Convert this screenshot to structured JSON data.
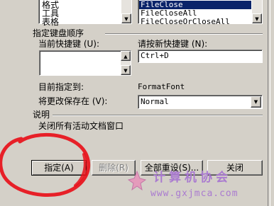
{
  "categories": {
    "items": [
      "格式",
      "工具",
      "表格"
    ]
  },
  "commands": {
    "items": [
      "FileClose",
      "FileCloseAll",
      "FileCloseOrCloseAll"
    ],
    "selected_index": 0
  },
  "keyboard": {
    "group_label": "指定键盘顺序",
    "current_keys_label": "当前快捷键 (U):",
    "new_key_label": "请按新快捷键 (N):",
    "new_key_value": "Ctrl+D",
    "assigned_to_label": "目前指定到:",
    "assigned_to_value": "FormatFont",
    "save_in_label": "将更改保存在 (V):",
    "save_in_value": "Normal"
  },
  "description": {
    "label": "说明",
    "text": "关闭所有活动文档窗口"
  },
  "buttons": {
    "assign": "指定(A)",
    "remove": "删除(R)",
    "reset_all": "全部重设(S)...",
    "close": "关闭"
  },
  "watermark": {
    "title": "计算机协会",
    "url": "www.gxjmca.com"
  },
  "colors": {
    "selection": "#0a246a",
    "annotation_circle": "#e8101a",
    "watermark": "#aa7bd0"
  }
}
